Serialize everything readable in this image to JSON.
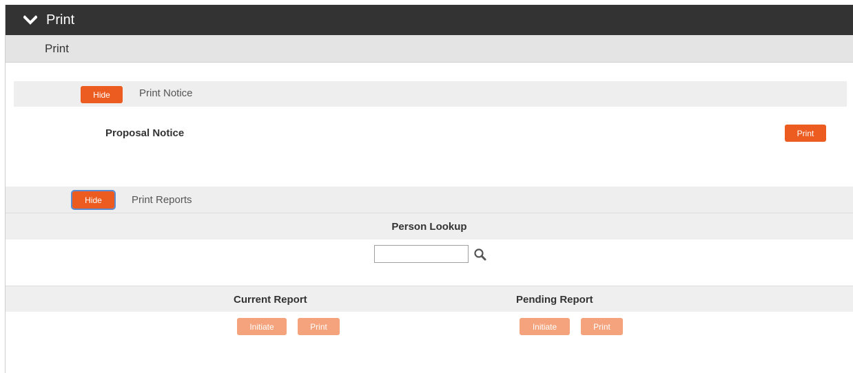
{
  "header": {
    "title": "Print",
    "chevron_icon": "chevron-down-icon"
  },
  "subheader": {
    "label": "Print"
  },
  "print_notice_section": {
    "hide_label": "Hide",
    "title": "Print Notice",
    "item_label": "Proposal Notice",
    "print_label": "Print"
  },
  "print_reports_section": {
    "hide_label": "Hide",
    "title": "Print Reports",
    "person_lookup": {
      "heading": "Person Lookup",
      "value": "",
      "search_icon": "search-icon"
    },
    "current_report": {
      "heading": "Current Report",
      "initiate_label": "Initiate",
      "print_label": "Print"
    },
    "pending_report": {
      "heading": "Pending Report",
      "initiate_label": "Initiate",
      "print_label": "Print"
    }
  },
  "colors": {
    "titlebar": "#333333",
    "accent": "#ec5b1f",
    "accent_light": "#f4a37c",
    "section_bg": "#eeeeee"
  }
}
